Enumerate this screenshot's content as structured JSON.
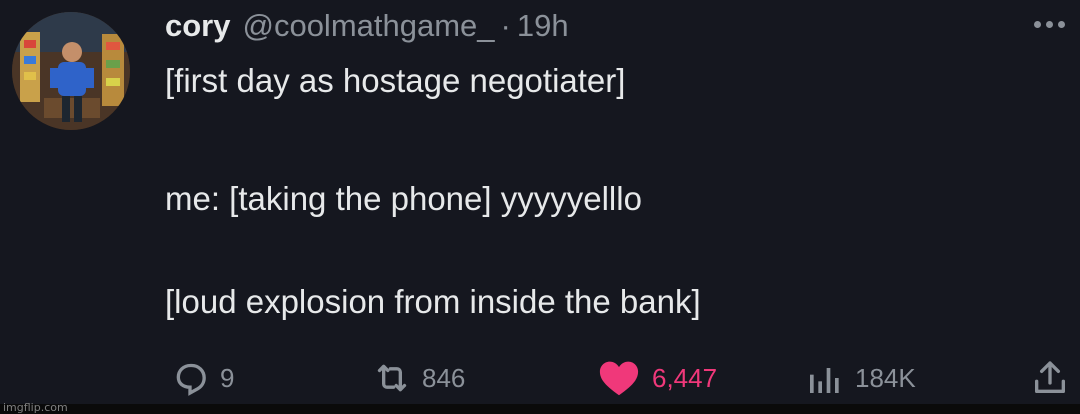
{
  "tweet": {
    "author": {
      "name": "cory",
      "handle": "@coolmathgame_",
      "separator": "·",
      "time": "19h"
    },
    "lines": [
      "[first day as hostage negotiater]",
      "me: [taking the phone] yyyyyelllo",
      "[loud explosion from inside the bank]"
    ],
    "actions": {
      "reply_count": "9",
      "retweet_count": "846",
      "like_count": "6,447",
      "views_count": "184K"
    },
    "icons": {
      "reply": "reply-icon",
      "retweet": "retweet-icon",
      "like": "heart-icon",
      "views": "views-icon",
      "share": "share-icon",
      "more": "more-icon"
    }
  },
  "colors": {
    "background": "#15171f",
    "text": "#e7e9ea",
    "muted": "#8b9199",
    "like": "#f0387a"
  },
  "watermark": "imgflip.com"
}
